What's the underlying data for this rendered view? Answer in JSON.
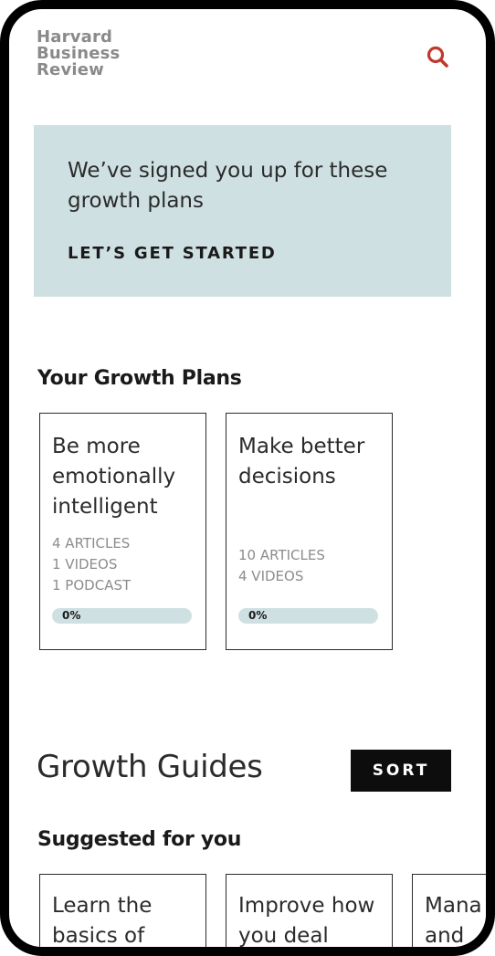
{
  "header": {
    "logo_lines": [
      "Harvard",
      "Business",
      "Review"
    ],
    "search_icon": "search-icon"
  },
  "banner": {
    "message": "We’ve signed you up for these growth plans",
    "cta": "LET’S GET STARTED"
  },
  "growth_plans": {
    "title": "Your Growth Plans",
    "cards": [
      {
        "title": "Be more emotionally intelligent",
        "meta": [
          "4 ARTICLES",
          "1 VIDEOS",
          "1 PODCAST"
        ],
        "progress_label": "0%",
        "progress": 0
      },
      {
        "title": "Make better decisions",
        "meta": [
          "10 ARTICLES",
          "4 VIDEOS"
        ],
        "progress_label": "0%",
        "progress": 0
      }
    ]
  },
  "growth_guides": {
    "title": "Growth Guides",
    "sort_label": "SORT",
    "suggested_title": "Suggested for you",
    "cards": [
      {
        "lines": [
          "Learn the",
          "basics of"
        ]
      },
      {
        "lines": [
          "Improve how",
          "you deal"
        ]
      },
      {
        "lines": [
          "Mana",
          "and"
        ]
      }
    ]
  },
  "colors": {
    "accent": "#c0392b",
    "banner_bg": "#cfe0e2",
    "progress_track": "#cfe0e2",
    "sort_bg": "#0d0d0d"
  }
}
